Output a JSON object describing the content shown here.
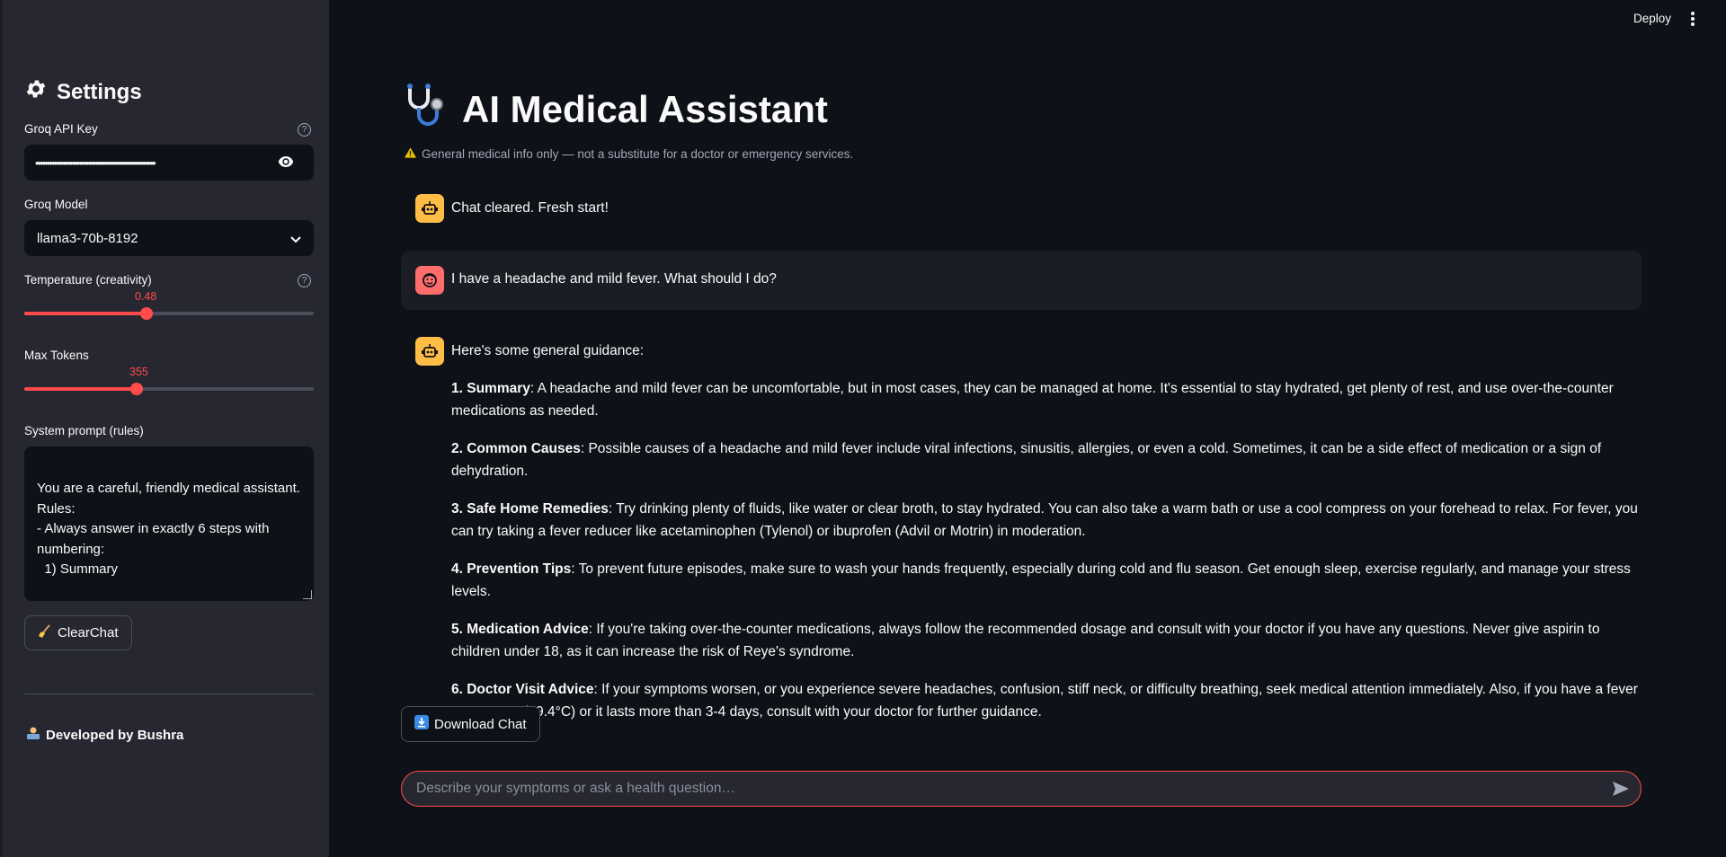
{
  "header": {
    "deploy_label": "Deploy",
    "menu_icon": "kebab-icon"
  },
  "sidebar": {
    "title": "Settings",
    "title_icon": "gear-icon",
    "api_key": {
      "label": "Groq API Key",
      "value": "••••••••••••••••••••••••••••••••••••••••••••••••••••",
      "help_icon": "help-icon",
      "toggle_icon": "eye-icon"
    },
    "model": {
      "label": "Groq Model",
      "value": "llama3-70b-8192",
      "icon": "chevron-down-icon"
    },
    "temperature": {
      "label": "Temperature (creativity)",
      "value": "0.48",
      "fraction": 0.42
    },
    "max_tokens": {
      "label": "Max Tokens",
      "value": "355",
      "fraction": 0.39
    },
    "system_prompt": {
      "label": "System prompt (rules)",
      "value": "You are a careful, friendly medical assistant.\nRules:\n- Always answer in exactly 6 steps with numbering:\n  1) Summary"
    },
    "clear_button": "ClearChat",
    "credit": "Developed by Bushra"
  },
  "main": {
    "title": "AI Medical Assistant",
    "title_icon": "stethoscope-icon",
    "disclaimer": "General medical info only — not a substitute for a doctor or emergency services.",
    "messages": [
      {
        "role": "assistant",
        "text": "Chat cleared. Fresh start!"
      },
      {
        "role": "user",
        "text": "I have a headache and mild fever. What should I do?"
      }
    ],
    "response": {
      "intro": "Here's some general guidance:",
      "steps": [
        {
          "head": "1. Summary",
          "body": ": A headache and mild fever can be uncomfortable, but in most cases, they can be managed at home. It's essential to stay hydrated, get plenty of rest, and use over-the-counter medications as needed."
        },
        {
          "head": "2. Common Causes",
          "body": ": Possible causes of a headache and mild fever include viral infections, sinusitis, allergies, or even a cold. Sometimes, it can be a side effect of medication or a sign of dehydration."
        },
        {
          "head": "3. Safe Home Remedies",
          "body": ": Try drinking plenty of fluids, like water or clear broth, to stay hydrated. You can also take a warm bath or use a cool compress on your forehead to relax. For fever, you can try taking a fever reducer like acetaminophen (Tylenol) or ibuprofen (Advil or Motrin) in moderation."
        },
        {
          "head": "4. Prevention Tips",
          "body": ": To prevent future episodes, make sure to wash your hands frequently, especially during cold and flu season. Get enough sleep, exercise regularly, and manage your stress levels."
        },
        {
          "head": "5. Medication Advice",
          "body": ": If you're taking over-the-counter medications, always follow the recommended dosage and consult with your doctor if you have any questions. Never give aspirin to children under 18, as it can increase the risk of Reye's syndrome."
        },
        {
          "head": "6. Doctor Visit Advice",
          "body": ": If your symptoms worsen, or you experience severe headaches, confusion, stiff neck, or difficulty breathing, seek medical attention immediately. Also, if you have a fever over 103°F (39.4°C) or it lasts more than 3-4 days, consult with your doctor for further guidance."
        }
      ]
    },
    "download_button": "Download Chat",
    "chat_placeholder": "Describe your symptoms or ask a health question…"
  },
  "colors": {
    "accent": "#ff4b4b",
    "bot_avatar": "#ffbd45",
    "user_avatar": "#ff6c6c",
    "background": "#0e1117",
    "sidebar": "#262730"
  }
}
